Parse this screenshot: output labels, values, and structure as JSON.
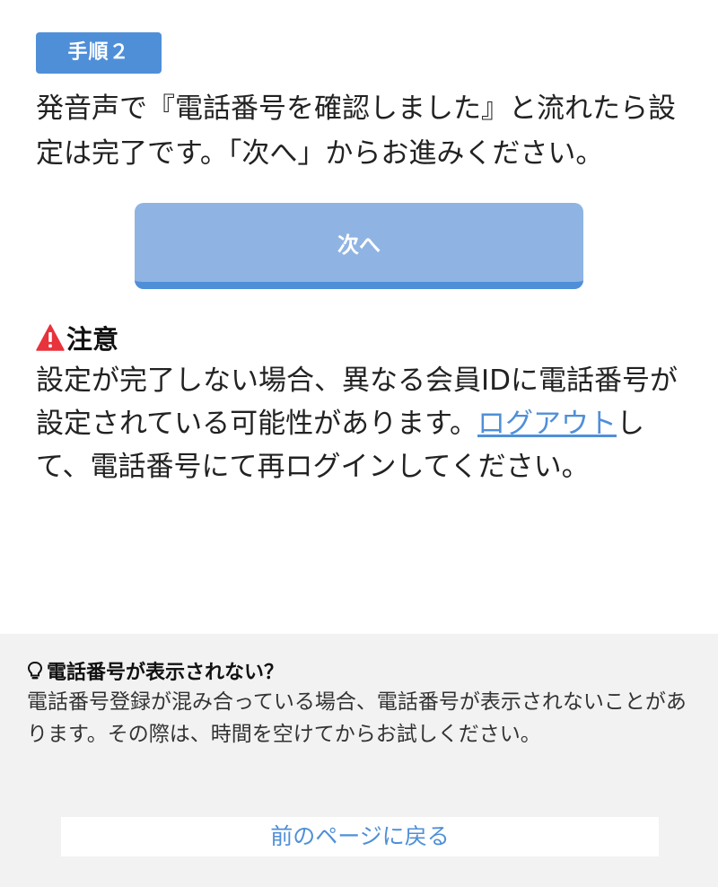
{
  "step": {
    "badge": "手順２",
    "instruction": "発音声で『電話番号を確認しました』と流れたら設定は完了です。「次へ」からお進みください。"
  },
  "next_button": {
    "label": "次へ"
  },
  "caution": {
    "icon": "warning-icon",
    "title": "注意",
    "text_before": "設定が完了しない場合、異なる会員IDに電話番号が設定されている可能性があります。",
    "logout_link": "ログアウト",
    "text_after": "して、電話番号にて再ログインしてください。"
  },
  "help": {
    "icon": "lightbulb-icon",
    "title": "電話番号が表示されない？",
    "text": "電話番号登録が混み合っている場合、電話番号が表示されないことがあります。その際は、時間を空けてからお試しください。"
  },
  "back_link": {
    "label": "前のページに戻る"
  },
  "colors": {
    "accent": "#4f8fd8",
    "button_bg": "#8fb4e3",
    "warning": "#e8323c",
    "help_bg": "#f2f2f2"
  }
}
